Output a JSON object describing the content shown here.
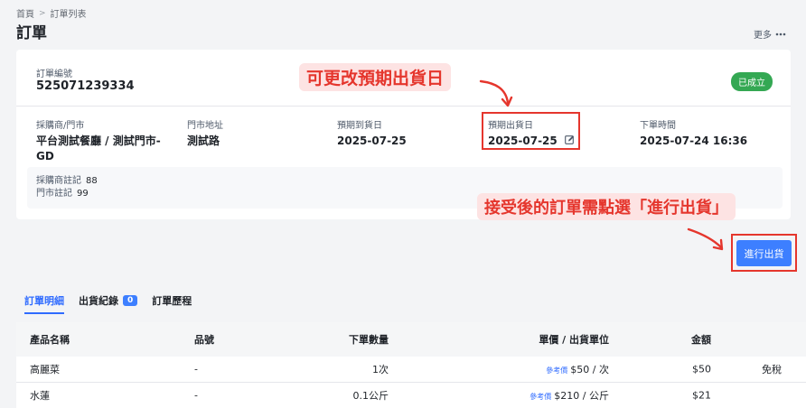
{
  "breadcrumb": {
    "home": "首頁",
    "separator": ">",
    "current": "訂單列表"
  },
  "page": {
    "title": "訂單",
    "more_label": "更多",
    "more_icon": "ellipsis-icon"
  },
  "order": {
    "number_label": "訂單編號",
    "number": "525071239334",
    "status": "已成立",
    "status_color": "#34a853",
    "buyer_label": "採購商/門市",
    "buyer_value": "平台測試餐廳 / 測試門市-GD",
    "address_label": "門市地址",
    "address_value": "測試路",
    "arrival_label": "預期到貨日",
    "arrival_value": "2025-07-25",
    "ship_label": "預期出貨日",
    "ship_value": "2025-07-25",
    "order_time_label": "下單時間",
    "order_time_value": "2025-07-24 16:36",
    "buyer_note_label": "採購商註記",
    "buyer_note_value": "88",
    "store_note_label": "門市註記",
    "store_note_value": "99"
  },
  "annotations": {
    "edit_ship_date": "可更改預期出貨日",
    "ship_instruction": "接受後的訂單需點選「進行出貨」",
    "accent_color": "#e5362d"
  },
  "actions": {
    "ship_button": "進行出貨",
    "ship_button_color": "#3d7fff"
  },
  "tabs": [
    {
      "label": "訂單明細",
      "active": true
    },
    {
      "label": "出貨紀錄",
      "badge": "0"
    },
    {
      "label": "訂單歷程"
    }
  ],
  "table": {
    "headers": {
      "name": "產品名稱",
      "code": "品號",
      "qty": "下單數量",
      "price": "單價 / 出貨單位",
      "amount": "金額"
    },
    "rows": [
      {
        "name": "高麗菜",
        "code": "-",
        "qty": "1次",
        "ref": "參考價",
        "price": "$50 / 次",
        "amount": "$50",
        "tax": "免稅"
      },
      {
        "name": "水蓮",
        "code": "-",
        "qty": "0.1公斤",
        "ref": "參考價",
        "price": "$210 / 公斤",
        "amount": "$21",
        "tax": ""
      }
    ]
  }
}
